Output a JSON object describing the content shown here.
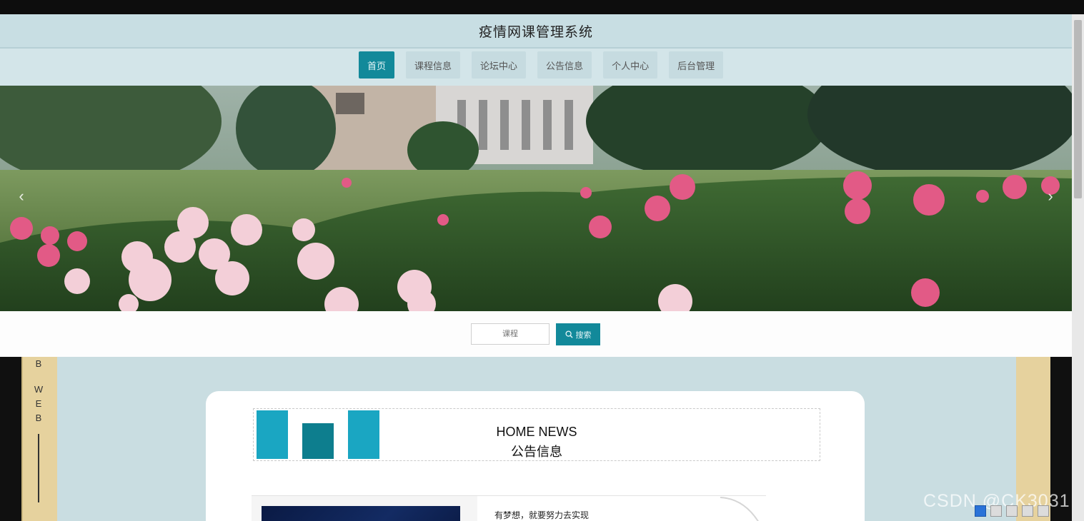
{
  "header": {
    "title": "疫情网课管理系统"
  },
  "nav": {
    "items": [
      {
        "label": "首页",
        "active": true
      },
      {
        "label": "课程信息",
        "active": false
      },
      {
        "label": "论坛中心",
        "active": false
      },
      {
        "label": "公告信息",
        "active": false
      },
      {
        "label": "个人中心",
        "active": false
      },
      {
        "label": "后台管理",
        "active": false
      }
    ]
  },
  "carousel": {
    "prev_label": "‹",
    "next_label": "›"
  },
  "search": {
    "placeholder": "课程",
    "button_label": "搜索"
  },
  "side": {
    "letters": [
      "B",
      "W",
      "E",
      "B"
    ]
  },
  "news": {
    "title_en": "HOME NEWS",
    "title_cn": "公告信息",
    "item_text": "有梦想，就要努力去实现"
  },
  "watermark": {
    "text": "CSDN @CK3031"
  },
  "colors": {
    "accent": "#12899a",
    "page_bg": "#c9dde1",
    "side_bg": "#e6d29e"
  }
}
